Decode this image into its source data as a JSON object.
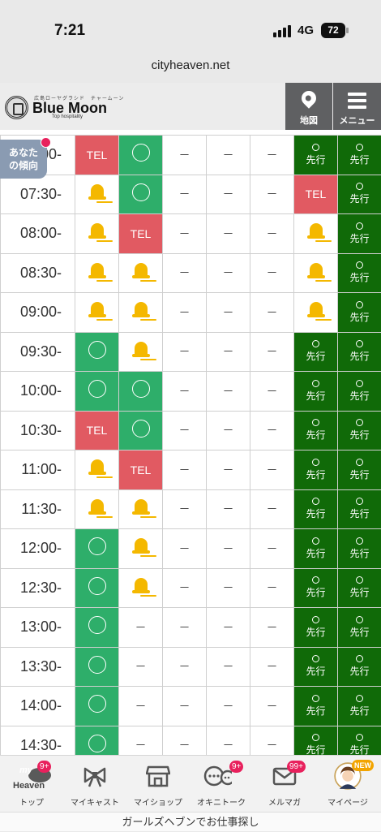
{
  "status_bar": {
    "time": "7:21",
    "network": "4G",
    "battery": "72"
  },
  "browser": {
    "url": "cityheaven.net"
  },
  "header": {
    "logo_small": "広島ローヤグラシド　チャームーン",
    "logo_main": "Blue Moon",
    "logo_sub": "Top hospitality",
    "map_label": "地図",
    "menu_label": "メニュー"
  },
  "tendency_button": {
    "label_line1": "あなた",
    "label_line2": "の傾向"
  },
  "schedule": {
    "rows": [
      {
        "time": "07:00-",
        "cells": [
          "tel",
          "open",
          "-",
          "-",
          "-",
          "advance",
          "advance"
        ]
      },
      {
        "time": "07:30-",
        "cells": [
          "bell",
          "open",
          "-",
          "-",
          "-",
          "tel",
          "advance"
        ]
      },
      {
        "time": "08:00-",
        "cells": [
          "bell",
          "tel",
          "-",
          "-",
          "-",
          "bell",
          "advance"
        ]
      },
      {
        "time": "08:30-",
        "cells": [
          "bell",
          "bell",
          "-",
          "-",
          "-",
          "bell",
          "advance"
        ]
      },
      {
        "time": "09:00-",
        "cells": [
          "bell",
          "bell",
          "-",
          "-",
          "-",
          "bell",
          "advance"
        ]
      },
      {
        "time": "09:30-",
        "cells": [
          "open",
          "bell",
          "-",
          "-",
          "-",
          "advance",
          "advance"
        ]
      },
      {
        "time": "10:00-",
        "cells": [
          "open",
          "open",
          "-",
          "-",
          "-",
          "advance",
          "advance"
        ]
      },
      {
        "time": "10:30-",
        "cells": [
          "tel",
          "open",
          "-",
          "-",
          "-",
          "advance",
          "advance"
        ]
      },
      {
        "time": "11:00-",
        "cells": [
          "bell",
          "tel",
          "-",
          "-",
          "-",
          "advance",
          "advance"
        ]
      },
      {
        "time": "11:30-",
        "cells": [
          "bell",
          "bell",
          "-",
          "-",
          "-",
          "advance",
          "advance"
        ]
      },
      {
        "time": "12:00-",
        "cells": [
          "open",
          "bell",
          "-",
          "-",
          "-",
          "advance",
          "advance"
        ]
      },
      {
        "time": "12:30-",
        "cells": [
          "open",
          "bell",
          "-",
          "-",
          "-",
          "advance",
          "advance"
        ]
      },
      {
        "time": "13:00-",
        "cells": [
          "open",
          "-",
          "-",
          "-",
          "-",
          "advance",
          "advance"
        ]
      },
      {
        "time": "13:30-",
        "cells": [
          "open",
          "-",
          "-",
          "-",
          "-",
          "advance",
          "advance"
        ]
      },
      {
        "time": "14:00-",
        "cells": [
          "open",
          "-",
          "-",
          "-",
          "-",
          "advance",
          "advance"
        ]
      },
      {
        "time": "14:30-",
        "cells": [
          "open",
          "-",
          "-",
          "-",
          "-",
          "advance",
          "advance"
        ]
      }
    ],
    "tel_label": "TEL",
    "advance_label": "先行",
    "dash_label": "－"
  },
  "bottom_nav": {
    "items": [
      {
        "label": "トップ",
        "icon": "my-heaven-icon",
        "badge": "9+"
      },
      {
        "label": "マイキャスト",
        "icon": "ribbon-icon"
      },
      {
        "label": "マイショップ",
        "icon": "shop-icon"
      },
      {
        "label": "オキニトーク",
        "icon": "chat-icon",
        "badge": "9+"
      },
      {
        "label": "メルマガ",
        "icon": "mail-icon",
        "badge": "99+"
      },
      {
        "label": "マイページ",
        "icon": "avatar-icon",
        "badge": "NEW"
      }
    ],
    "my_heaven_text": "my",
    "heaven_text": "Heaven"
  },
  "footer": {
    "text": "ガールズヘブンでお仕事探し"
  },
  "colors": {
    "open": "#2eae6a",
    "tel": "#e15a62",
    "advance": "#106a08",
    "bell": "#f4b800"
  }
}
